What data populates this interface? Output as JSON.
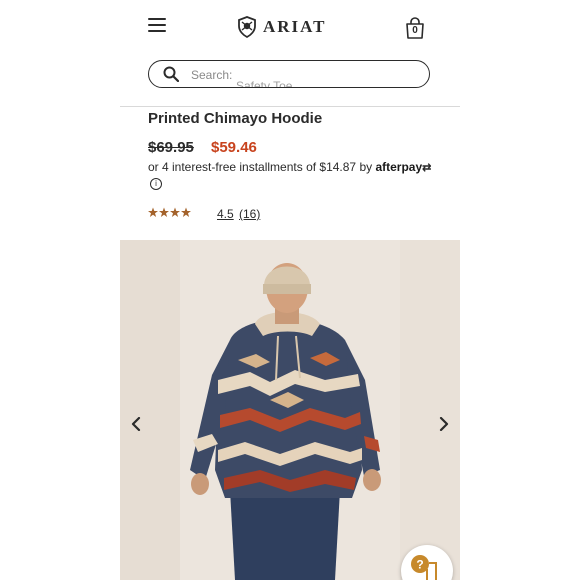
{
  "header": {
    "brand": "ARIAT",
    "cart_count": "0"
  },
  "search": {
    "placeholder": "Search:",
    "hint": "Safety Toe"
  },
  "product": {
    "title": "Printed Chimayo Hoodie",
    "price_original": "$69.95",
    "price_sale": "$59.46",
    "installments_text": "or 4 interest-free installments of $14.87 by",
    "afterpay_label": "afterpay",
    "rating_value": "4.5",
    "rating_stars": 4.5,
    "reviews_count": "(16)"
  },
  "colors": {
    "text": "#2b2b2b",
    "sale_price": "#c8431e",
    "stars": "#a4632c",
    "help_accent": "#c7892b"
  },
  "icons": [
    "menu-icon",
    "ariat-logo-icon",
    "bag-icon",
    "search-icon",
    "info-icon",
    "chevron-left-icon",
    "chevron-right-icon",
    "help-chat-icon"
  ]
}
